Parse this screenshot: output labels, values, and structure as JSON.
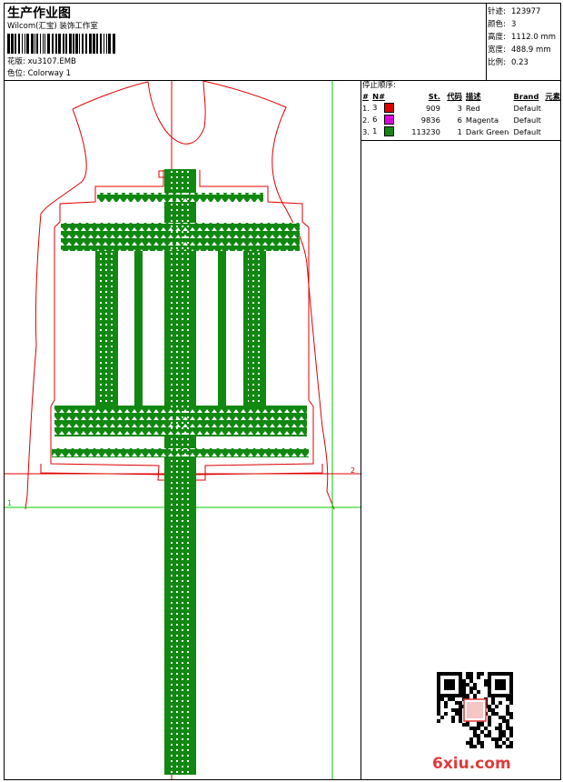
{
  "header": {
    "title": "生产作业图",
    "company": "Wilcom(汇宝) 装饰工作室",
    "design_label": "花版:",
    "design_value": "xu3107.EMB",
    "colorway_label": "色位:",
    "colorway_value": "Colorway 1"
  },
  "specs": [
    {
      "label": "针迹:",
      "value": "123977"
    },
    {
      "label": "颜色:",
      "value": "3"
    },
    {
      "label": "高度:",
      "value": "1112.0 mm"
    },
    {
      "label": "宽度:",
      "value": "488.9 mm"
    },
    {
      "label": "比例:",
      "value": "0.23"
    }
  ],
  "stop_sequence": {
    "title": "停止顺序:",
    "columns": [
      "#",
      "N#",
      "St.",
      "代码",
      "描述",
      "Brand",
      "元素"
    ],
    "rows": [
      {
        "idx": "1.",
        "n": "3",
        "color": "#dd0000",
        "stitches": "909",
        "code": "3",
        "desc": "Red",
        "brand": "Default"
      },
      {
        "idx": "2.",
        "n": "6",
        "color": "#dd00dd",
        "stitches": "9836",
        "code": "6",
        "desc": "Magenta",
        "brand": "Default"
      },
      {
        "idx": "3.",
        "n": "1",
        "color": "#118811",
        "stitches": "113230",
        "code": "1",
        "desc": "Dark Green",
        "brand": "Default"
      }
    ]
  },
  "canvas": {
    "marker_1": "1",
    "marker_2": "2"
  },
  "watermark": {
    "text": "6xiu.com",
    "accent": "#e03a3a"
  },
  "colors": {
    "outline": "#e00000",
    "guide": "#00cc00",
    "fill": "#118811"
  }
}
